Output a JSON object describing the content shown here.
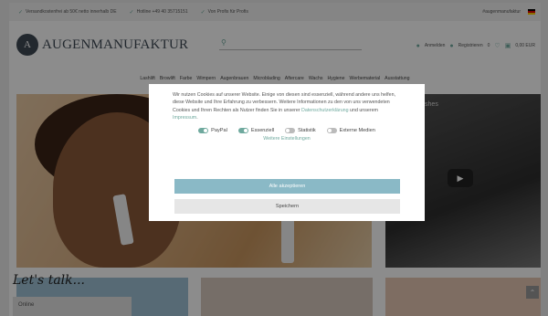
{
  "topbar": {
    "usps": [
      "Versandkostenfrei ab 50€ netto innerhalb DE",
      "Hotline +49 40 35715151",
      "Von Profis für Profis"
    ],
    "brand_link": "#augenmanufaktur"
  },
  "header": {
    "logo_mark": "A",
    "logo_text": "AUGENMANUFAKTUR",
    "search_placeholder": "",
    "login_label": "Anmelden",
    "register_label": "Registrieren",
    "wishlist_count": "0",
    "cart_total": "0,00 EUR"
  },
  "nav": {
    "items": [
      "Lashlift",
      "Browlift",
      "Farbe",
      "Wimpern",
      "Augenbrauen",
      "Microblading",
      "Aftercare",
      "Wachs",
      "Hygiene",
      "Werbematerial",
      "Ausstattung"
    ]
  },
  "hero": {
    "video_title": "Fanning Lashes",
    "chat_heading": "Let's talk...",
    "chat_label": "Online"
  },
  "cookie": {
    "text_before_links": "Wir nutzen Cookies auf unserer Website. Einige von diesen sind essenziell, während andere uns helfen, diese Website und Ihre Erfahrung zu verbessern. Weitere Informationen zu den von uns verwendeten Cookies und Ihren Rechten als Nutzer finden Sie in unserer ",
    "privacy_link": "Datenschutzerklärung",
    "text_between": " und unserem ",
    "imprint_link": "Impressum",
    "text_end": ".",
    "toggles": [
      {
        "label": "PayPal",
        "on": true
      },
      {
        "label": "Essenziell",
        "on": true
      },
      {
        "label": "Statistik",
        "on": false
      },
      {
        "label": "Externe Medien",
        "on": false
      }
    ],
    "more_settings": "Weitere Einstellungen",
    "accept_all": "Alle akzeptieren",
    "save": "Speichern"
  },
  "colors": {
    "accent": "#6fa99e",
    "accept_button": "#8ab9c6",
    "overlay": "rgba(0,0,0,0.45)"
  }
}
